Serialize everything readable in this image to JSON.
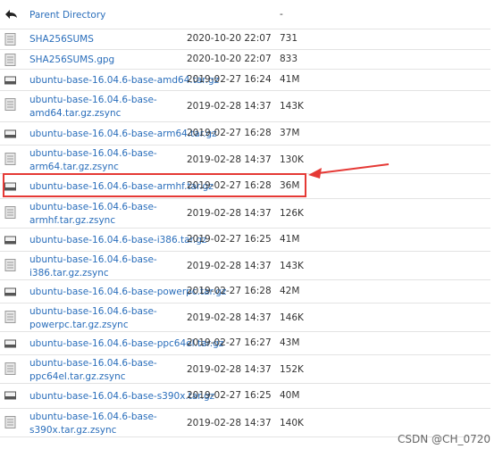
{
  "listing": {
    "parent": {
      "name": "Parent Directory",
      "date": "",
      "size": "-"
    },
    "rows": [
      {
        "name": "SHA256SUMS",
        "date": "2020-10-20 22:07",
        "size": "731",
        "icon": "text-file-icon"
      },
      {
        "name": "SHA256SUMS.gpg",
        "date": "2020-10-20 22:07",
        "size": "833",
        "icon": "text-file-icon"
      },
      {
        "name": "ubuntu-base-16.04.6-base-amd64.tar.gz",
        "date": "2019-02-27 16:24",
        "size": "41M",
        "icon": "archive-icon"
      },
      {
        "name": "ubuntu-base-16.04.6-base-\namd64.tar.gz.zsync",
        "date": "2019-02-28 14:37",
        "size": "143K",
        "icon": "text-file-icon"
      },
      {
        "name": "ubuntu-base-16.04.6-base-arm64.tar.gz",
        "date": "2019-02-27 16:28",
        "size": "37M",
        "icon": "archive-icon"
      },
      {
        "name": "ubuntu-base-16.04.6-base-\narm64.tar.gz.zsync",
        "date": "2019-02-28 14:37",
        "size": "130K",
        "icon": "text-file-icon"
      },
      {
        "name": "ubuntu-base-16.04.6-base-armhf.tar.gz",
        "date": "2019-02-27 16:28",
        "size": "36M",
        "icon": "archive-icon"
      },
      {
        "name": "ubuntu-base-16.04.6-base-\narmhf.tar.gz.zsync",
        "date": "2019-02-28 14:37",
        "size": "126K",
        "icon": "text-file-icon"
      },
      {
        "name": "ubuntu-base-16.04.6-base-i386.tar.gz",
        "date": "2019-02-27 16:25",
        "size": "41M",
        "icon": "archive-icon"
      },
      {
        "name": "ubuntu-base-16.04.6-base-\ni386.tar.gz.zsync",
        "date": "2019-02-28 14:37",
        "size": "143K",
        "icon": "text-file-icon"
      },
      {
        "name": "ubuntu-base-16.04.6-base-powerpc.tar.gz",
        "date": "2019-02-27 16:28",
        "size": "42M",
        "icon": "archive-icon"
      },
      {
        "name": "ubuntu-base-16.04.6-base-\npowerpc.tar.gz.zsync",
        "date": "2019-02-28 14:37",
        "size": "146K",
        "icon": "text-file-icon"
      },
      {
        "name": "ubuntu-base-16.04.6-base-ppc64el.tar.gz",
        "date": "2019-02-27 16:27",
        "size": "43M",
        "icon": "archive-icon"
      },
      {
        "name": "ubuntu-base-16.04.6-base-\nppc64el.tar.gz.zsync",
        "date": "2019-02-28 14:37",
        "size": "152K",
        "icon": "text-file-icon"
      },
      {
        "name": "ubuntu-base-16.04.6-base-s390x.tar.gz",
        "date": "2019-02-27 16:25",
        "size": "40M",
        "icon": "archive-icon"
      },
      {
        "name": "ubuntu-base-16.04.6-base-\ns390x.tar.gz.zsync",
        "date": "2019-02-28 14:37",
        "size": "140K",
        "icon": "text-file-icon"
      }
    ]
  },
  "watermark": "CSDN @CH_0720",
  "colors": {
    "link": "#2a6ebb",
    "highlight": "#e53935"
  }
}
